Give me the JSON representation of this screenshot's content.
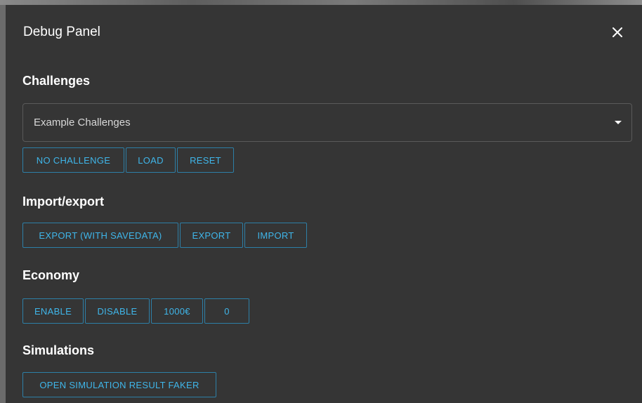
{
  "dialog": {
    "title": "Debug Panel",
    "close_icon": "close-icon"
  },
  "challenges": {
    "heading": "Challenges",
    "select": {
      "value": "Example Challenges",
      "arrow_icon": "caret-down-icon"
    },
    "buttons": [
      "NO CHALLENGE",
      "LOAD",
      "RESET"
    ]
  },
  "import_export": {
    "heading": "Import/export",
    "buttons": [
      "EXPORT (WITH SAVEDATA)",
      "EXPORT",
      "IMPORT"
    ]
  },
  "economy": {
    "heading": "Economy",
    "buttons": [
      "ENABLE",
      "DISABLE",
      "1000€",
      "0"
    ]
  },
  "simulations": {
    "heading": "Simulations",
    "buttons": [
      "OPEN SIMULATION RESULT FAKER"
    ]
  },
  "colors": {
    "dialog_bg": "#353535",
    "accent": "#3fb6ea",
    "border_accent": "#2d7fa7",
    "text": "#ffffff"
  }
}
